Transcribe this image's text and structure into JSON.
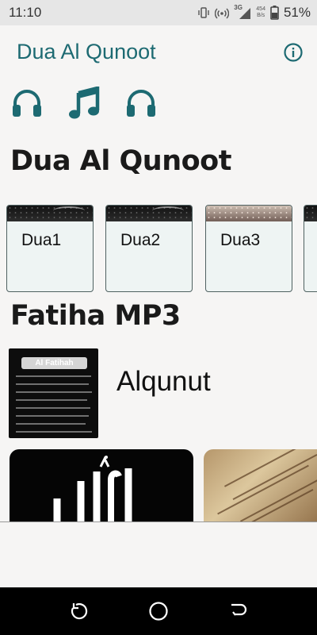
{
  "status_bar": {
    "time": "11:10",
    "network_speed_value": "454",
    "network_speed_unit": "B/s",
    "network_type": "3G",
    "battery_percent": "51%",
    "icons": [
      "vibrate-icon",
      "hotspot-icon",
      "signal-icon",
      "battery-icon"
    ]
  },
  "header": {
    "title": "Dua Al Qunoot",
    "info_icon": "info-icon"
  },
  "toolbar": {
    "items": [
      {
        "icon": "headphones-icon"
      },
      {
        "icon": "music-note-icon"
      },
      {
        "icon": "headphones-icon"
      }
    ]
  },
  "sections": {
    "dua_title": "Dua Al Qunoot",
    "fatiha_title": "Fatiha MP3"
  },
  "dua_cards": [
    {
      "label": "Dua1"
    },
    {
      "label": "Dua2"
    },
    {
      "label": "Dua3"
    }
  ],
  "fatiha_item": {
    "label": "Alqunut",
    "thumb_badge": "Al Fatihah"
  },
  "navbar": {
    "icons": [
      "recents-icon",
      "home-icon",
      "back-icon"
    ]
  },
  "colors": {
    "accent": "#1d6a72",
    "background": "#f6f5f4",
    "card_background": "#eef4f3"
  }
}
